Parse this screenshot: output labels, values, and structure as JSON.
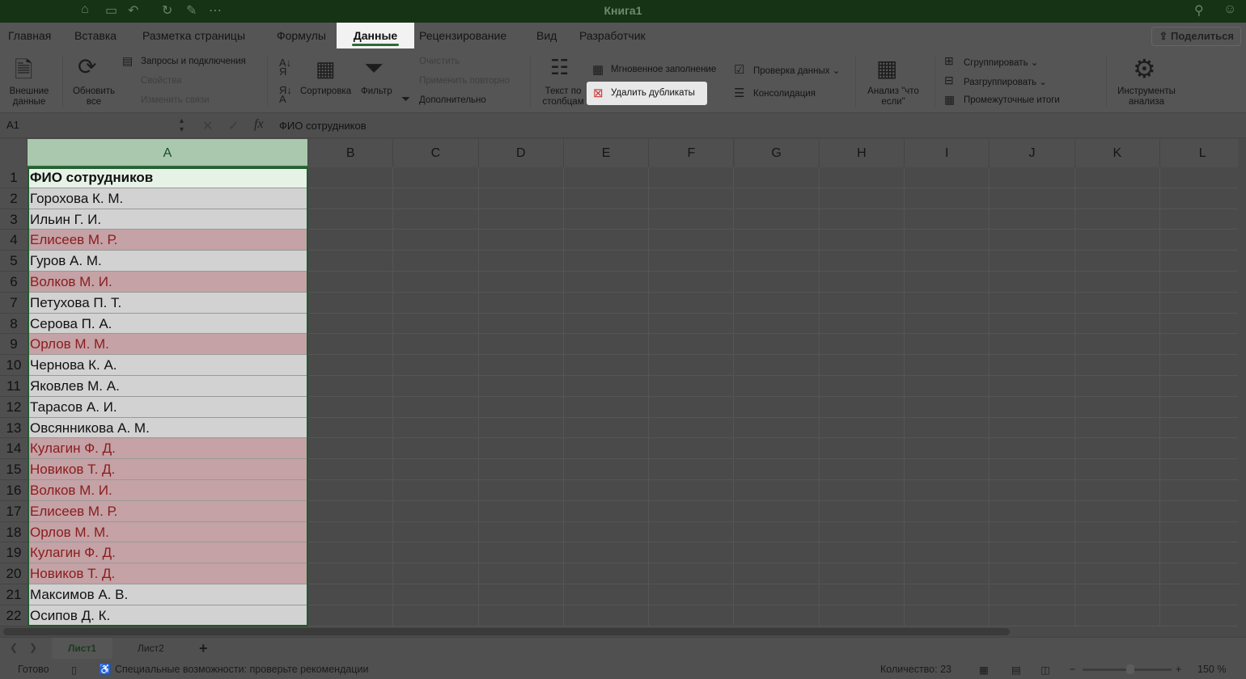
{
  "title": "Книга1",
  "tabs": [
    "Главная",
    "Вставка",
    "Разметка страницы",
    "Формулы",
    "Данные",
    "Рецензирование",
    "Вид",
    "Разработчик"
  ],
  "active_tab": "Данные",
  "share_label": "Поделиться",
  "ribbon": {
    "external_data": "Внешние данные",
    "refresh_all": "Обновить все",
    "queries": "Запросы и подключения",
    "properties": "Свойства",
    "edit_links": "Изменить связи",
    "sort": "Сортировка",
    "filter": "Фильтр",
    "clear": "Очистить",
    "reapply": "Применить повторно",
    "advanced": "Дополнительно",
    "text_to_columns": "Текст по столбцам",
    "flash_fill": "Мгновенное заполнение",
    "remove_duplicates": "Удалить дубликаты",
    "data_validation": "Проверка данных",
    "consolidate": "Консолидация",
    "what_if": "Анализ \"что если\"",
    "group": "Сгруппировать",
    "ungroup": "Разгруппировать",
    "subtotal": "Промежуточные итоги",
    "analysis_tools": "Инструменты анализа"
  },
  "name_box": "A1",
  "formula": "ФИО сотрудников",
  "columns": [
    "A",
    "B",
    "C",
    "D",
    "E",
    "F",
    "G",
    "H",
    "I",
    "J",
    "K",
    "L"
  ],
  "rows": [
    {
      "n": "1",
      "v": "ФИО сотрудников",
      "dup": false,
      "header": true
    },
    {
      "n": "2",
      "v": "Горохова К. М.",
      "dup": false
    },
    {
      "n": "3",
      "v": "Ильин Г. И.",
      "dup": false
    },
    {
      "n": "4",
      "v": "Елисеев М. Р.",
      "dup": true
    },
    {
      "n": "5",
      "v": "Гуров А. М.",
      "dup": false
    },
    {
      "n": "6",
      "v": "Волков М. И.",
      "dup": true
    },
    {
      "n": "7",
      "v": "Петухова П. Т.",
      "dup": false
    },
    {
      "n": "8",
      "v": "Серова П. А.",
      "dup": false
    },
    {
      "n": "9",
      "v": "Орлов М. М.",
      "dup": true
    },
    {
      "n": "10",
      "v": "Чернова К. А.",
      "dup": false
    },
    {
      "n": "11",
      "v": "Яковлев М. А.",
      "dup": false
    },
    {
      "n": "12",
      "v": "Тарасов А. И.",
      "dup": false
    },
    {
      "n": "13",
      "v": "Овсянникова А. М.",
      "dup": false
    },
    {
      "n": "14",
      "v": "Кулагин Ф. Д.",
      "dup": true
    },
    {
      "n": "15",
      "v": "Новиков Т. Д.",
      "dup": true
    },
    {
      "n": "16",
      "v": "Волков М. И.",
      "dup": true
    },
    {
      "n": "17",
      "v": "Елисеев М. Р.",
      "dup": true
    },
    {
      "n": "18",
      "v": "Орлов М. М.",
      "dup": true
    },
    {
      "n": "19",
      "v": "Кулагин Ф. Д.",
      "dup": true
    },
    {
      "n": "20",
      "v": "Новиков Т. Д.",
      "dup": true
    },
    {
      "n": "21",
      "v": "Максимов А. В.",
      "dup": false
    },
    {
      "n": "22",
      "v": "Осипов Д. К.",
      "dup": false
    }
  ],
  "sheets": [
    "Лист1",
    "Лист2"
  ],
  "add_sheet": "+",
  "status": {
    "ready": "Готово",
    "accessibility": "Специальные возможности: проверьте рекомендации",
    "count": "Количество: 23",
    "zoom": "150 %"
  },
  "colors": {
    "dup_fill": "#c4a2a6",
    "dup_text": "#8a1c1c",
    "cell_fill": "#d2d2d2",
    "header_fill": "#e6f2e6"
  }
}
